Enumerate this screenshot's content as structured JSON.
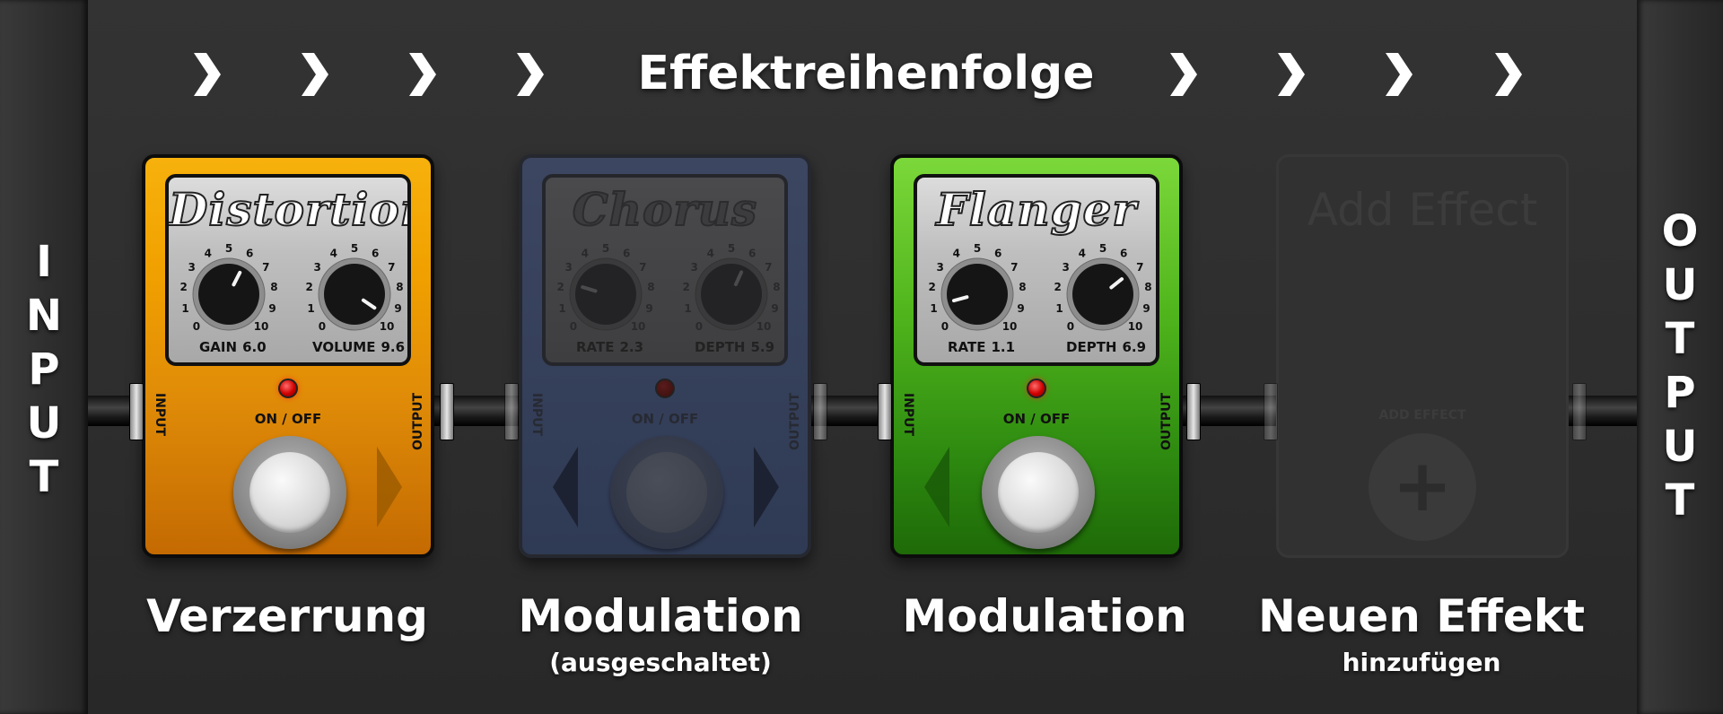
{
  "header": {
    "title": "Effektreihenfolge"
  },
  "rails": {
    "input": "INPUT",
    "output": "OUTPUT"
  },
  "pedals": [
    {
      "name": "Distortion",
      "enabled": true,
      "color": "#f0a000",
      "knob1": {
        "label": "GAIN",
        "value": "6.0",
        "level": 6.0
      },
      "knob2": {
        "label": "VOLUME",
        "value": "9.6",
        "level": 9.6
      },
      "onoff": "ON / OFF",
      "input_label": "INPUT",
      "output_label": "OUTPUT",
      "caption": "Verzerrung",
      "subcaption": ""
    },
    {
      "name": "Chorus",
      "enabled": false,
      "color": "#2f3a54",
      "knob1": {
        "label": "RATE",
        "value": "2.3",
        "level": 2.3
      },
      "knob2": {
        "label": "DEPTH",
        "value": "5.9",
        "level": 5.9
      },
      "onoff": "ON / OFF",
      "input_label": "INPUT",
      "output_label": "OUTPUT",
      "caption": "Modulation",
      "subcaption": "(ausgeschaltet)"
    },
    {
      "name": "Flanger",
      "enabled": true,
      "color": "#4fb41c",
      "knob1": {
        "label": "RATE",
        "value": "1.1",
        "level": 1.1
      },
      "knob2": {
        "label": "DEPTH",
        "value": "6.9",
        "level": 6.9
      },
      "onoff": "ON / OFF",
      "input_label": "INPUT",
      "output_label": "OUTPUT",
      "caption": "Modulation",
      "subcaption": ""
    }
  ],
  "add_effect": {
    "title": "Add Effect",
    "small_label": "ADD EFFECT",
    "icon": "plus-icon",
    "caption": "Neuen Effekt",
    "subcaption": "hinzufügen"
  },
  "dial_scale": [
    "0",
    "1",
    "2",
    "3",
    "4",
    "5",
    "6",
    "7",
    "8",
    "9",
    "10"
  ]
}
